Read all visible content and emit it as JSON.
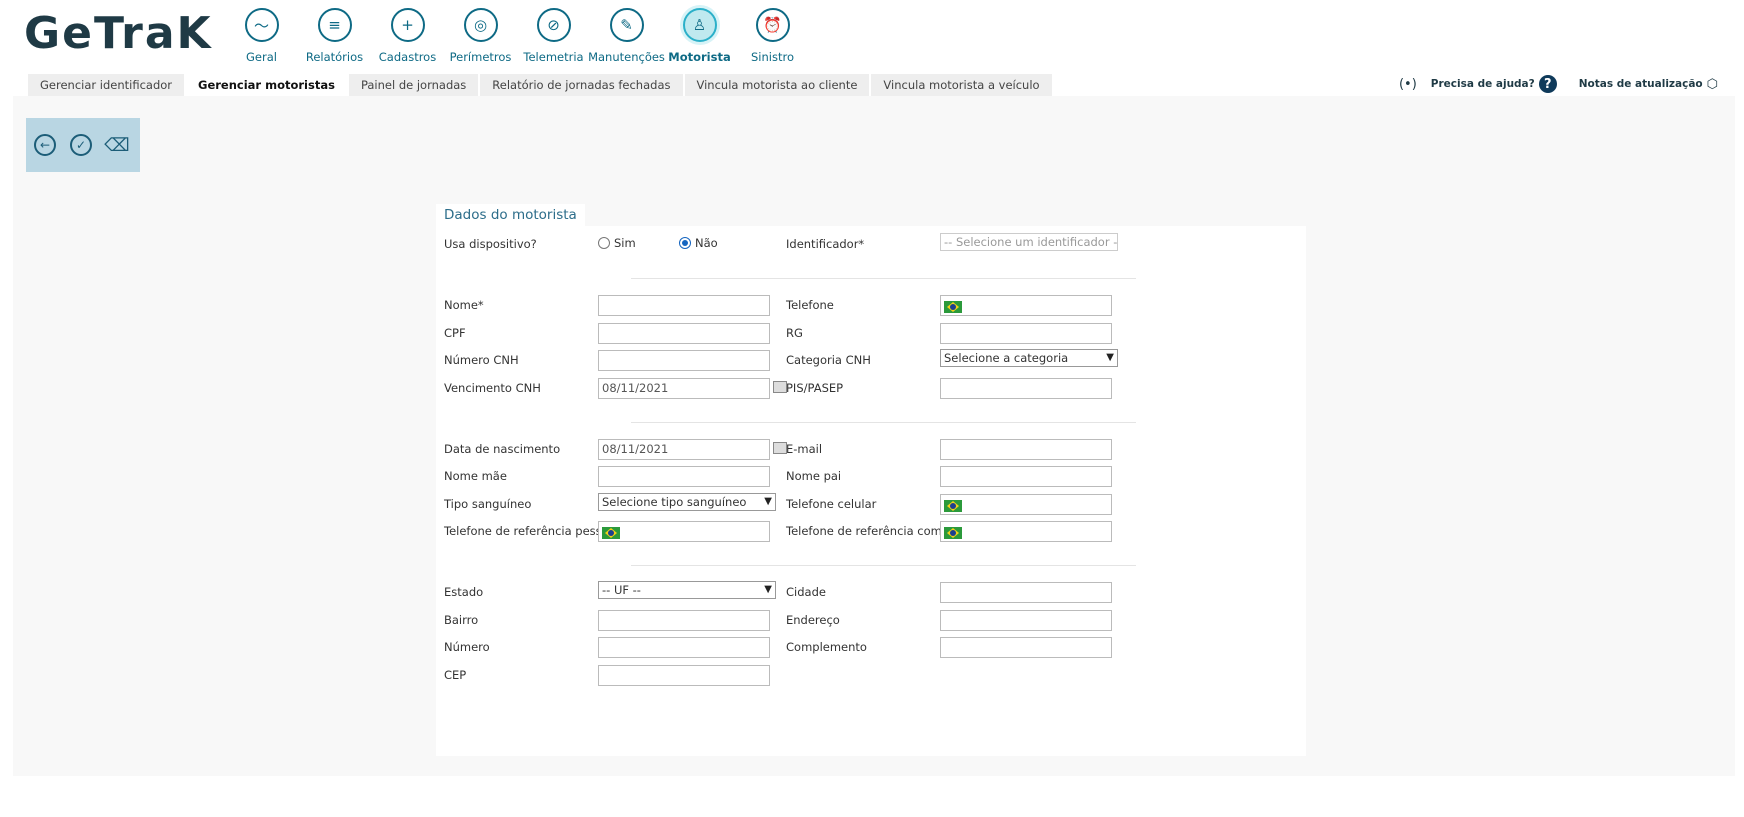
{
  "logo": {
    "text": "GeTraK"
  },
  "nav": {
    "items": [
      {
        "label": "Geral",
        "icon": "monitor-icon",
        "glyph": "〜"
      },
      {
        "label": "Relatórios",
        "icon": "report-icon",
        "glyph": "≡"
      },
      {
        "label": "Cadastros",
        "icon": "folder-plus-icon",
        "glyph": "+"
      },
      {
        "label": "Perímetros",
        "icon": "target-icon",
        "glyph": "◎"
      },
      {
        "label": "Telemetria",
        "icon": "compass-icon",
        "glyph": "⊘"
      },
      {
        "label": "Manutenções",
        "icon": "wrench-icon",
        "glyph": "✎"
      },
      {
        "label": "Motorista",
        "icon": "driver-icon",
        "glyph": "♙"
      },
      {
        "label": "Sinistro",
        "icon": "alarm-icon",
        "glyph": "⏰"
      }
    ],
    "active": "Motorista"
  },
  "subtabs": [
    {
      "label": "Gerenciar identificador"
    },
    {
      "label": "Gerenciar motoristas"
    },
    {
      "label": "Painel de jornadas"
    },
    {
      "label": "Relatório de jornadas fechadas"
    },
    {
      "label": "Vincula motorista ao cliente"
    },
    {
      "label": "Vincula motorista a veículo"
    }
  ],
  "topright": {
    "help_label": "Precisa de ajuda?",
    "help_glyph": "?",
    "notes_label": "Notas de atualização",
    "signal_glyph": "(•)",
    "notes_glyph": "⬡"
  },
  "toolbar": {
    "back_glyph": "←",
    "save_glyph": "✓",
    "clear_glyph": "⌫"
  },
  "form": {
    "title": "Dados do motorista",
    "usa_dispositivo": "Usa dispositivo?",
    "sim": "Sim",
    "nao": "Não",
    "identificador": "Identificador*",
    "identificador_placeholder": "-- Selecione um identificador --",
    "nome": "Nome*",
    "telefone": "Telefone",
    "cpf": "CPF",
    "rg": "RG",
    "numero_cnh": "Número CNH",
    "categoria_cnh": "Categoria CNH",
    "categoria_placeholder": "Selecione a categoria",
    "vencimento_cnh": "Vencimento CNH",
    "vencimento_value": "08/11/2021",
    "pis_pasep": "PIS/PASEP",
    "data_nascimento": "Data de nascimento",
    "nascimento_value": "08/11/2021",
    "email": "E-mail",
    "nome_mae": "Nome mãe",
    "nome_pai": "Nome pai",
    "tipo_sanguineo": "Tipo sanguíneo",
    "tipo_placeholder": "Selecione tipo sanguíneo",
    "telefone_celular": "Telefone celular",
    "tel_ref_pessoal": "Telefone de referência pessoal",
    "tel_ref_comercial": "Telefone de referência comercial",
    "estado": "Estado",
    "estado_placeholder": "-- UF --",
    "cidade": "Cidade",
    "bairro": "Bairro",
    "endereco": "Endereço",
    "numero": "Número",
    "complemento": "Complemento",
    "cep": "CEP"
  },
  "colors": {
    "accent": "#0e6a85",
    "toolbar_bg": "#b9d6e3",
    "active_nav_bg": "#bfe9ef"
  }
}
